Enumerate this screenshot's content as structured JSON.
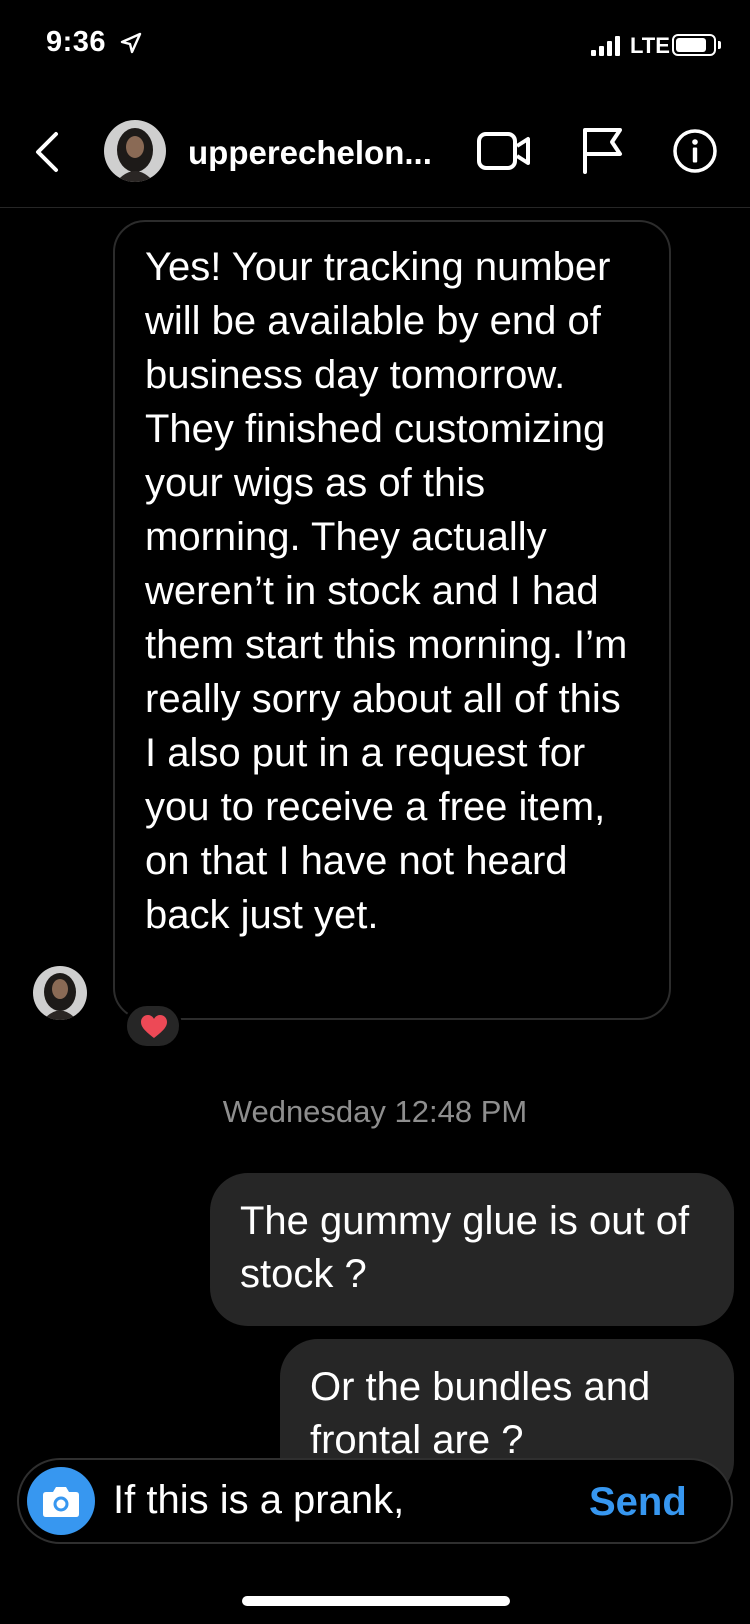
{
  "status_bar": {
    "time": "9:36",
    "network": "LTE"
  },
  "header": {
    "username": "upperechelon..."
  },
  "messages": [
    {
      "direction": "incoming",
      "text": "Yes! Your tracking number will be available by end of business day tomorrow. They finished customizing your wigs as of this morning. They actually weren’t in stock and I had them start this morning. I’m really sorry about all of this I also put in a request for you to receive a free item, on that I have not heard back just yet.",
      "reaction": "heart-icon"
    },
    {
      "direction": "outgoing",
      "text": "The gummy glue is out of stock ?"
    },
    {
      "direction": "outgoing",
      "text": "Or the bundles and frontal are ?"
    }
  ],
  "timestamp": "Wednesday 12:48 PM",
  "composer": {
    "value": "If this is a prank,",
    "send_label": "Send"
  },
  "colors": {
    "accent": "#3797f0",
    "bubble_out": "#262626",
    "background": "#000000",
    "heart": "#ed4956"
  }
}
